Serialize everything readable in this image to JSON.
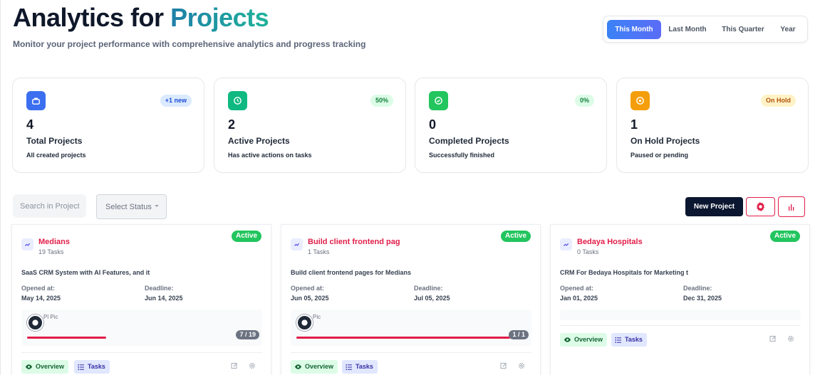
{
  "header": {
    "title_prefix": "Analytics for",
    "title_accent": "Projects",
    "subtitle": "Monitor your project performance with comprehensive analytics and progress tracking"
  },
  "period_filter": {
    "options": [
      "This Month",
      "Last Month",
      "This Quarter",
      "Year"
    ],
    "selected": "This Month"
  },
  "stats": [
    {
      "icon": "briefcase-icon",
      "color": "#3b6ff0",
      "badge": "+1 new",
      "badge_bg": "#dbeafe",
      "badge_fg": "#1d4ed8",
      "value": "4",
      "label": "Total Projects",
      "desc": "All created projects"
    },
    {
      "icon": "clock-icon",
      "color": "#10b981",
      "badge": "50%",
      "badge_bg": "#dcfce7",
      "badge_fg": "#15803d",
      "value": "2",
      "label": "Active Projects",
      "desc": "Has active actions on tasks"
    },
    {
      "icon": "check-circle-icon",
      "color": "#22c55e",
      "badge": "0%",
      "badge_bg": "#dcfce7",
      "badge_fg": "#15803d",
      "value": "0",
      "label": "Completed Projects",
      "desc": "Successfully finished"
    },
    {
      "icon": "pause-circle-icon",
      "color": "#f59e0b",
      "badge": "On Hold",
      "badge_bg": "#fef3c7",
      "badge_fg": "#b45309",
      "value": "1",
      "label": "On Hold Projects",
      "desc": "Paused or pending"
    }
  ],
  "toolbar": {
    "search_placeholder": "Search in Projects",
    "status_placeholder": "Select Status",
    "new_project_label": "New Project"
  },
  "projects": [
    {
      "name": "Medians",
      "tasks": "19 Tasks",
      "status": "Active",
      "description": "SaaS CRM System with AI Features, and it",
      "opened_label": "Opened at:",
      "opened": "May 14, 2025",
      "deadline_label": "Deadline:",
      "deadline": "Jun 14, 2025",
      "img_alt": "Pl Pic",
      "progress": 0.37,
      "progress_text": "7 / 19",
      "overview_label": "Overview",
      "tasks_label": "Tasks"
    },
    {
      "name": "Build client frontend pag",
      "tasks": "1 Tasks",
      "status": "Active",
      "description": "Build client frontend pages for Medians",
      "opened_label": "Opened at:",
      "opened": "Jun 05, 2025",
      "deadline_label": "Deadline:",
      "deadline": "Jul 05, 2025",
      "img_alt": "Pic",
      "progress": 1.0,
      "progress_text": "1 / 1",
      "overview_label": "Overview",
      "tasks_label": "Tasks"
    },
    {
      "name": "Bedaya Hospitals",
      "tasks": "0 Tasks",
      "status": "Active",
      "description": "CRM For Bedaya Hospitals for Marketing t",
      "opened_label": "Opened at:",
      "opened": "Jan 01, 2025",
      "deadline_label": "Deadline:",
      "deadline": "Dec 31, 2025",
      "overview_label": "Overview",
      "tasks_label": "Tasks"
    }
  ]
}
